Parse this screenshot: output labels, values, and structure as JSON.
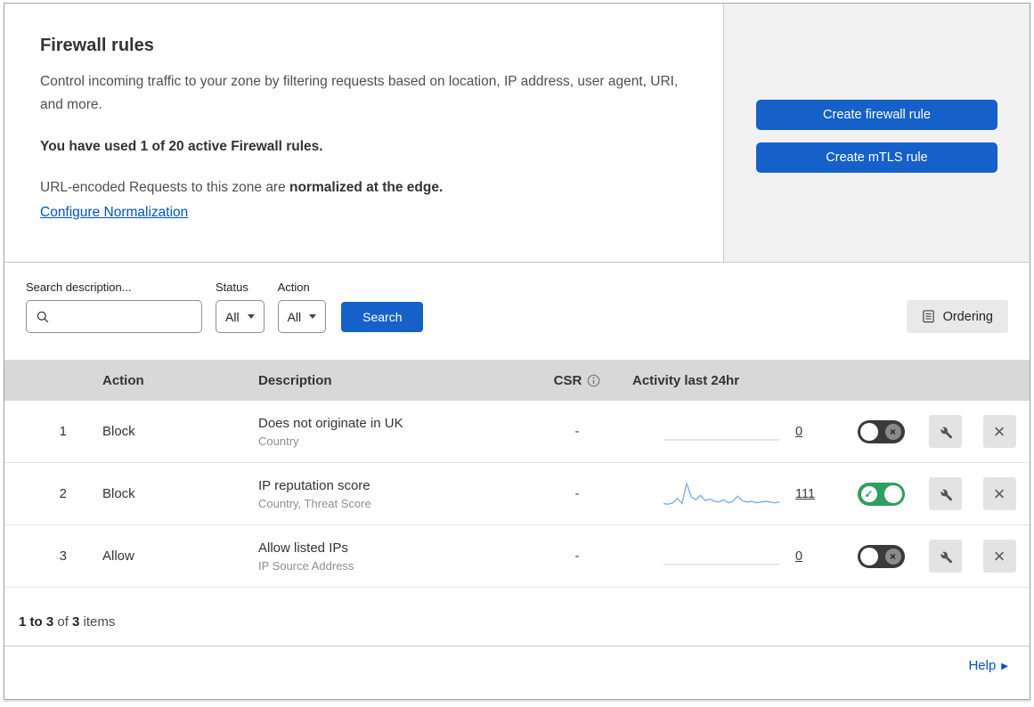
{
  "intro": {
    "title": "Firewall rules",
    "description": "Control incoming traffic to your zone by filtering requests based on location, IP address, user agent, URI, and more.",
    "usage": "You have used 1 of 20 active Firewall rules.",
    "normalization_prefix": "URL-encoded Requests to this zone are ",
    "normalization_bold": "normalized at the edge.",
    "configure_link": "Configure Normalization"
  },
  "actions_panel": {
    "create_firewall_rule": "Create firewall rule",
    "create_mtls_rule": "Create mTLS rule"
  },
  "filters": {
    "search_label": "Search description...",
    "status_label": "Status",
    "status_value": "All",
    "action_label": "Action",
    "action_value": "All",
    "search_button": "Search",
    "ordering_button": "Ordering"
  },
  "table": {
    "headers": {
      "action": "Action",
      "description": "Description",
      "csr": "CSR",
      "activity": "Activity last 24hr"
    },
    "rows": [
      {
        "num": "1",
        "action": "Block",
        "description": "Does not originate in UK",
        "fields": "Country",
        "csr": "-",
        "count": "0",
        "enabled": false,
        "sparkline": []
      },
      {
        "num": "2",
        "action": "Block",
        "description": "IP reputation score",
        "fields": "Country, Threat Score",
        "csr": "-",
        "count": "111",
        "enabled": true,
        "sparkline": [
          3,
          2,
          4,
          10,
          3,
          30,
          12,
          8,
          14,
          7,
          9,
          6,
          5,
          8,
          4,
          6,
          13,
          7,
          5,
          6,
          4,
          5,
          6,
          5,
          4,
          5
        ]
      },
      {
        "num": "3",
        "action": "Allow",
        "description": "Allow listed IPs",
        "fields": "IP Source Address",
        "csr": "-",
        "count": "0",
        "enabled": false,
        "sparkline": []
      }
    ]
  },
  "footer": {
    "range": "1 to 3",
    "of": " of ",
    "total": "3",
    "items": " items",
    "help": "Help"
  },
  "icons": {
    "close": "×",
    "check": "✓",
    "cross": "×",
    "help_arrow": "▶"
  },
  "colors": {
    "primary_blue": "#1660c9",
    "link_blue": "#0051c3",
    "toggle_green": "#2f9e5f",
    "toggle_off": "#3a3a3a",
    "sparkline_blue": "#7fb0e0",
    "header_gray": "#d8d8d8",
    "panel_gray": "#f1f1f1"
  }
}
